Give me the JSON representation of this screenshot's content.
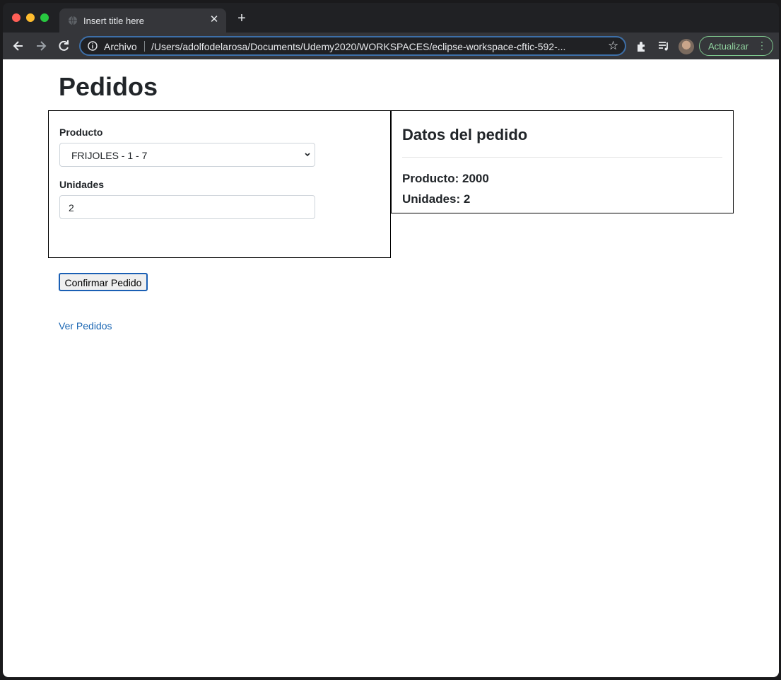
{
  "browser": {
    "tab_title": "Insert title here",
    "address_scheme": "Archivo",
    "address_url": "/Users/adolfodelarosa/Documents/Udemy2020/WORKSPACES/eclipse-workspace-cftic-592-...",
    "update_label": "Actualizar"
  },
  "page": {
    "title": "Pedidos",
    "form": {
      "product_label": "Producto",
      "product_selected": "FRIJOLES - 1 - 7",
      "units_label": "Unidades",
      "units_value": "2"
    },
    "summary": {
      "title": "Datos del pedido",
      "product_line": "Producto: 2000",
      "units_line": "Unidades: 2"
    },
    "confirm_label": "Confirmar Pedido",
    "view_link": "Ver Pedidos"
  },
  "colors": {
    "link": "#1a66b3",
    "update_accent": "#8fd19e",
    "focus_border": "#1a5fb4"
  }
}
